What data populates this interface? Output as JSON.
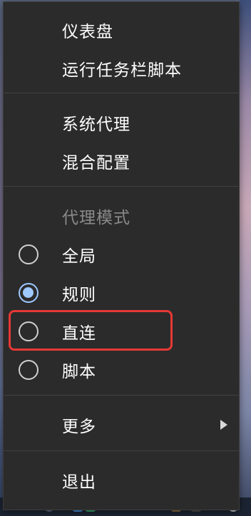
{
  "menu": {
    "dashboard": "仪表盘",
    "run_taskbar_script": "运行任务栏脚本",
    "system_proxy": "系统代理",
    "mixed_config": "混合配置",
    "proxy_mode_header": "代理模式",
    "modes": [
      {
        "label": "全局",
        "checked": false
      },
      {
        "label": "规则",
        "checked": true
      },
      {
        "label": "直连",
        "checked": false
      },
      {
        "label": "脚本",
        "checked": false
      }
    ],
    "more": "更多",
    "exit": "退出"
  },
  "colors": {
    "menu_bg": "#2b2b2b",
    "radio_checked": "#9fc8ff",
    "annotation_box": "#e53935"
  }
}
